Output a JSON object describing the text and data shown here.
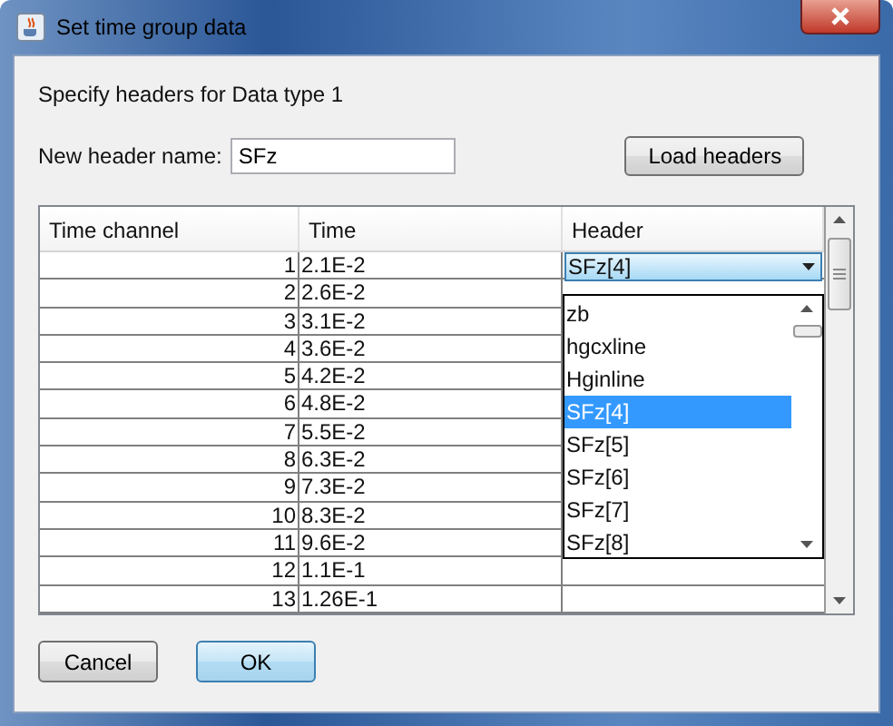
{
  "window": {
    "title": "Set time group data"
  },
  "instruction": "Specify headers for Data type 1",
  "header_name": {
    "label": "New header name:",
    "value": "SFz"
  },
  "load_button": "Load headers",
  "table": {
    "columns": [
      "Time channel",
      "Time",
      "Header"
    ],
    "rows": [
      {
        "channel": "1",
        "time": "2.1E-2",
        "header": "SFz[4]"
      },
      {
        "channel": "2",
        "time": "2.6E-2"
      },
      {
        "channel": "3",
        "time": "3.1E-2"
      },
      {
        "channel": "4",
        "time": "3.6E-2"
      },
      {
        "channel": "5",
        "time": "4.2E-2"
      },
      {
        "channel": "6",
        "time": "4.8E-2"
      },
      {
        "channel": "7",
        "time": "5.5E-2"
      },
      {
        "channel": "8",
        "time": "6.3E-2"
      },
      {
        "channel": "9",
        "time": "7.3E-2"
      },
      {
        "channel": "10",
        "time": "8.3E-2"
      },
      {
        "channel": "11",
        "time": "9.6E-2"
      },
      {
        "channel": "12",
        "time": "1.1E-1"
      },
      {
        "channel": "13",
        "time": "1.26E-1"
      }
    ]
  },
  "dropdown": {
    "options": [
      {
        "label": "zb",
        "selected": false
      },
      {
        "label": "hgcxline",
        "selected": false
      },
      {
        "label": "Hginline",
        "selected": false
      },
      {
        "label": "SFz[4]",
        "selected": true
      },
      {
        "label": "SFz[5]",
        "selected": false
      },
      {
        "label": "SFz[6]",
        "selected": false
      },
      {
        "label": "SFz[7]",
        "selected": false
      },
      {
        "label": "SFz[8]",
        "selected": false
      }
    ]
  },
  "buttons": [
    {
      "label": "Cancel",
      "default": false
    },
    {
      "label": "OK",
      "default": true
    }
  ]
}
